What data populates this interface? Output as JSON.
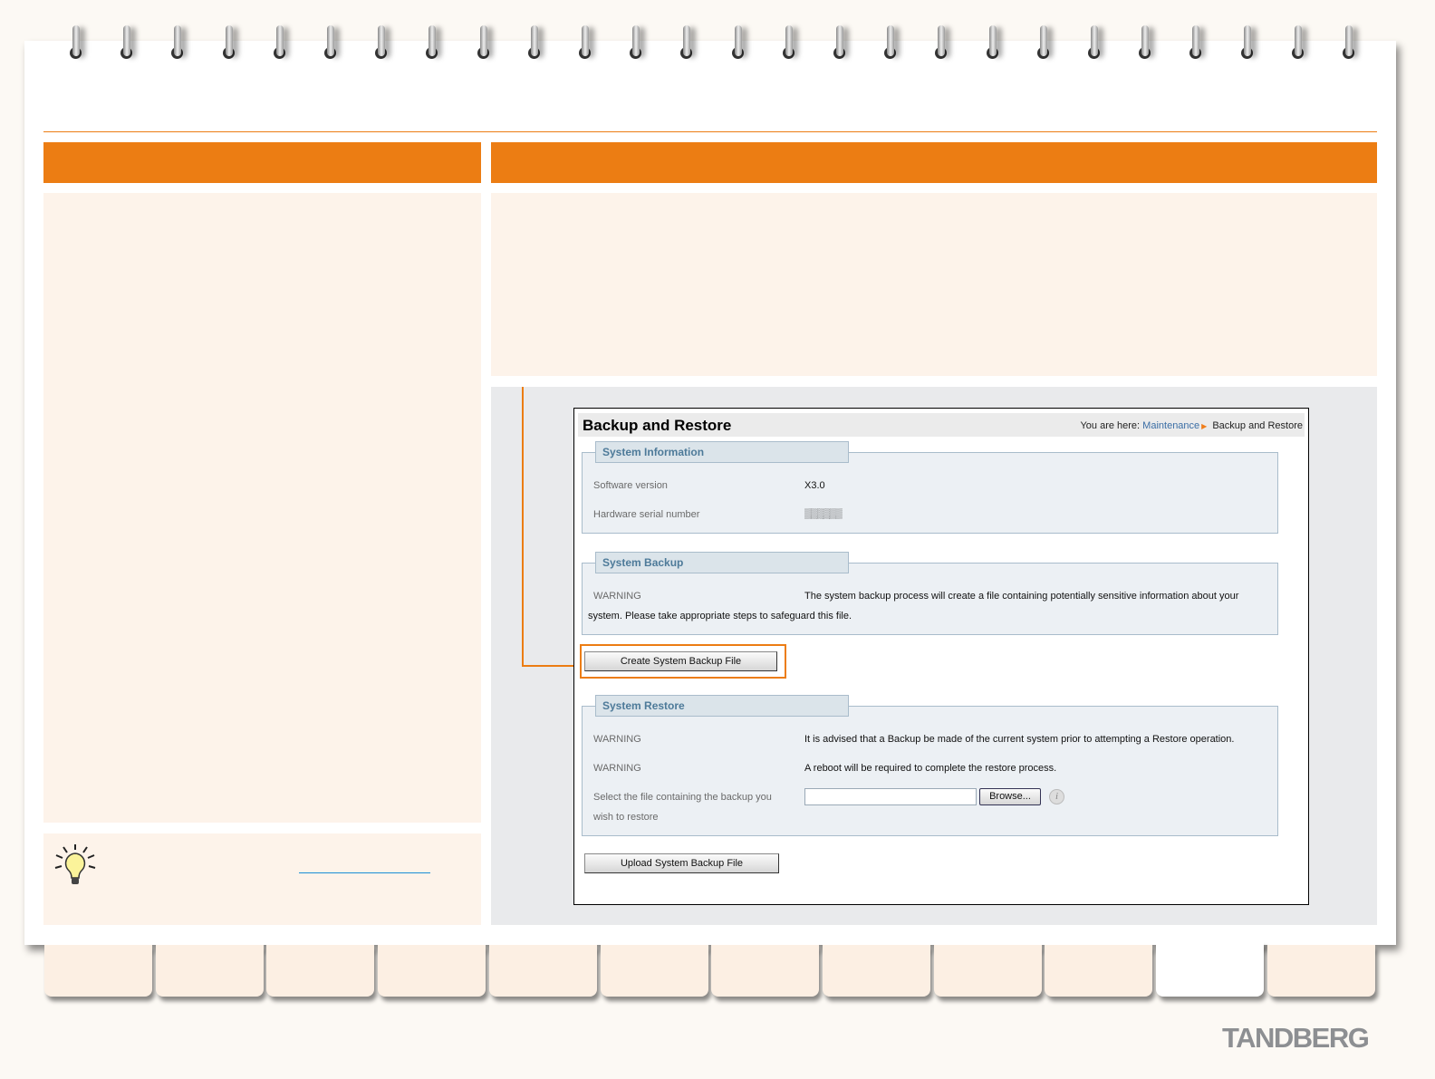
{
  "window": {
    "title": "Backup and Restore",
    "breadcrumb_prefix": "You are here:",
    "breadcrumb_link": "Maintenance",
    "breadcrumb_current": "Backup and Restore"
  },
  "system_information": {
    "legend": "System Information",
    "rows": [
      {
        "label": "Software version",
        "value": "X3.0"
      },
      {
        "label": "Hardware serial number",
        "value": "▒▒▒▒▒▒"
      }
    ]
  },
  "system_backup": {
    "legend": "System Backup",
    "warning_label": "WARNING",
    "warning_text": "The system backup process will create a file containing potentially sensitive information about your",
    "warning_text2": "system. Please take appropriate steps to safeguard this file.",
    "button": "Create System Backup File"
  },
  "system_restore": {
    "legend": "System Restore",
    "warnings": [
      {
        "label": "WARNING",
        "text": "It is advised that a Backup be made of the current system prior to attempting a Restore operation."
      },
      {
        "label": "WARNING",
        "text": "A reboot will be required to complete the restore process."
      }
    ],
    "file_label": "Select the file containing the backup you",
    "file_label2": "wish to restore",
    "file_value": "",
    "browse": "Browse...",
    "info": "i",
    "upload_button": "Upload System Backup File"
  },
  "brand": {
    "logo": "TANDBERG",
    "accent": "#ec7d13"
  }
}
